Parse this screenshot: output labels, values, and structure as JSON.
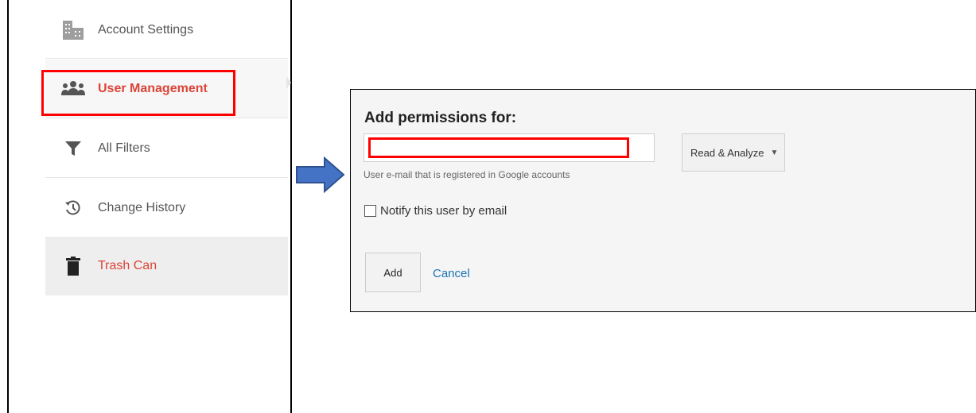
{
  "sidebar": {
    "items": [
      {
        "label": "Account Settings",
        "icon": "building-icon"
      },
      {
        "label": "User Management",
        "icon": "users-icon"
      },
      {
        "label": "All Filters",
        "icon": "filter-icon"
      },
      {
        "label": "Change History",
        "icon": "history-icon"
      },
      {
        "label": "Trash Can",
        "icon": "trash-icon"
      }
    ],
    "active_color": "#db4437",
    "highlight_color": "#ff0000"
  },
  "arrow": {
    "icon": "right-arrow-icon",
    "color": "#4472c4"
  },
  "dialog": {
    "title": "Add permissions for:",
    "email": {
      "value": "",
      "placeholder": "",
      "hint": "User e-mail that is registered in Google accounts"
    },
    "role": {
      "selected": "Read & Analyze"
    },
    "notify": {
      "label": "Notify this user by email",
      "checked": false
    },
    "add_label": "Add",
    "cancel_label": "Cancel"
  }
}
